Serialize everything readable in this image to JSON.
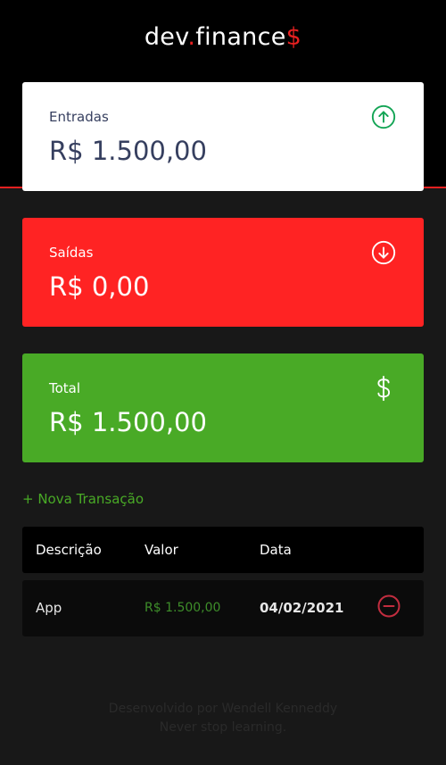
{
  "header": {
    "logo_prefix": "dev",
    "logo_dot": ".",
    "logo_main": "finance",
    "logo_suffix": "$"
  },
  "cards": {
    "income": {
      "label": "Entradas",
      "value": "R$ 1.500,00",
      "icon": "arrow-up-circle-icon"
    },
    "expense": {
      "label": "Saídas",
      "value": "R$ 0,00",
      "icon": "arrow-down-circle-icon"
    },
    "total": {
      "label": "Total",
      "value": "R$ 1.500,00",
      "icon": "dollar-icon"
    }
  },
  "actions": {
    "new_transaction": "+ Nova Transação"
  },
  "table": {
    "headers": {
      "description": "Descrição",
      "amount": "Valor",
      "date": "Data"
    },
    "rows": [
      {
        "description": "App",
        "amount": "R$ 1.500,00",
        "date": "04/02/2021",
        "remove_icon": "minus-circle-icon"
      }
    ]
  },
  "footer": {
    "line1": "Desenvolvido por Wendell Kenneddy",
    "line2": "Never stop learning."
  },
  "colors": {
    "background": "#181818",
    "header": "#000000",
    "accent_red": "#ff2323",
    "accent_green": "#49aa26",
    "text_dark": "#363f5f"
  }
}
